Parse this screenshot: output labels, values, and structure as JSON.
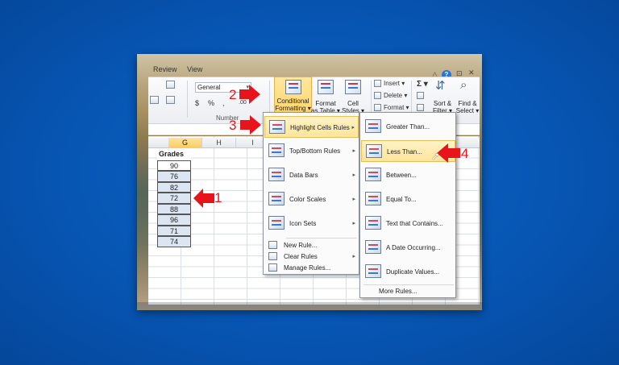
{
  "ribbon": {
    "tabs": [
      "Review",
      "View"
    ],
    "number_format": "General",
    "currency": "$",
    "percent": "%",
    "comma": ",",
    "decimal": ".00",
    "group_number": "Number",
    "conditional_formatting": [
      "Conditional",
      "Formatting ▾"
    ],
    "format_as_table": [
      "Format",
      "as Table ▾"
    ],
    "cell_styles": [
      "Cell",
      "Styles ▾"
    ],
    "insert": "Insert ▾",
    "delete": "Delete ▾",
    "format": "Format ▾",
    "sum": "Σ ▾",
    "sort_filter": [
      "Sort &",
      "Filter ▾"
    ],
    "find_select": [
      "Find &",
      "Select ▾"
    ]
  },
  "sheet": {
    "columns": [
      "G",
      "H",
      "I"
    ],
    "header": "Grades",
    "grades": [
      "90",
      "76",
      "82",
      "72",
      "88",
      "96",
      "71",
      "74"
    ]
  },
  "menu1": {
    "items": [
      {
        "label": "Highlight Cells Rules",
        "arrow": "▸"
      },
      {
        "label": "Top/Bottom Rules",
        "arrow": "▸"
      },
      {
        "label": "Data Bars",
        "arrow": "▸"
      },
      {
        "label": "Color Scales",
        "arrow": "▸"
      },
      {
        "label": "Icon Sets",
        "arrow": "▸"
      }
    ],
    "small": [
      {
        "label": "New Rule..."
      },
      {
        "label": "Clear Rules",
        "arrow": "▸"
      },
      {
        "label": "Manage Rules..."
      }
    ]
  },
  "menu2": {
    "items": [
      "Greater Than...",
      "Less Than...",
      "Between...",
      "Equal To...",
      "Text that Contains...",
      "A Date Occurring...",
      "Duplicate Values..."
    ],
    "more": "More Rules..."
  },
  "steps": [
    "1",
    "2",
    "3",
    "4"
  ],
  "colors": {
    "arrow": "#e8141c",
    "highlight": "#ffe49a",
    "selection": "#dce6f3",
    "background": "#0652b0"
  }
}
